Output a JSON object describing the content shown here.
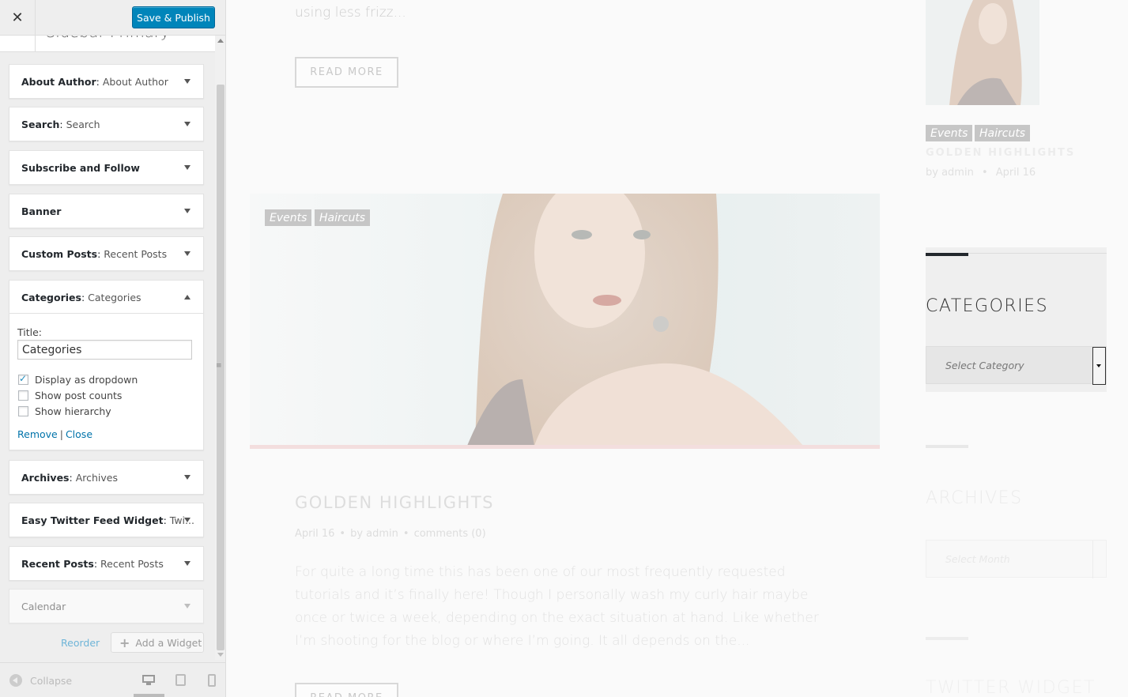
{
  "customizer": {
    "close_icon": "close-icon",
    "save_label": "Save & Publish",
    "section_title": "Sidebar Primary",
    "widgets": [
      {
        "type": "About Author",
        "instance": "About Author"
      },
      {
        "type": "Search",
        "instance": "Search"
      },
      {
        "type": "Subscribe and Follow",
        "instance": ""
      },
      {
        "type": "Banner",
        "instance": ""
      },
      {
        "type": "Custom Posts",
        "instance": "Recent Posts"
      },
      {
        "type": "Categories",
        "instance": "Categories"
      },
      {
        "type": "Archives",
        "instance": "Archives"
      },
      {
        "type": "Easy Twitter Feed Widget",
        "instance": "Twi..."
      },
      {
        "type": "Recent Posts",
        "instance": "Recent Posts"
      },
      {
        "type": "Calendar",
        "instance": ""
      }
    ],
    "categories_form": {
      "title_label": "Title:",
      "title_value": "Categories",
      "options": [
        {
          "label": "Display as dropdown",
          "checked": true
        },
        {
          "label": "Show post counts",
          "checked": false
        },
        {
          "label": "Show hierarchy",
          "checked": false
        }
      ],
      "remove_label": "Remove",
      "separator": "|",
      "close_label": "Close"
    },
    "reorder_label": "Reorder",
    "add_widget_label": "Add a Widget",
    "collapse_label": "Collapse"
  },
  "preview": {
    "excerpt_top": "using less frizz...",
    "read_more": "READ MORE",
    "tags": [
      "Events",
      "Haircuts"
    ],
    "post_title": "GOLDEN HIGHLIGHTS",
    "post_date": "April 16",
    "post_by": "by",
    "post_author": "admin",
    "post_comments": "comments (0)",
    "post_excerpt": "For quite a long time this has been one of our most frequently requested tutorials and it’s finally here! Though I personally wash my curly hair maybe once or twice a week, depending on the exact situation at hand. Like whether I’m shooting for the blog or where I’m going. It all depends on the...",
    "sidebar": {
      "recent_title": "GOLDEN HIGHLIGHTS",
      "recent_by": "by",
      "recent_author": "admin",
      "recent_date": "April 16",
      "categories_heading": "CATEGORIES",
      "categories_placeholder": "Select Category",
      "archives_heading": "ARCHIVES",
      "archives_placeholder": "Select Month",
      "twitter_heading": "TWITTER WIDGET"
    }
  },
  "colors": {
    "primary": "#0085ba",
    "link": "#0073aa"
  }
}
